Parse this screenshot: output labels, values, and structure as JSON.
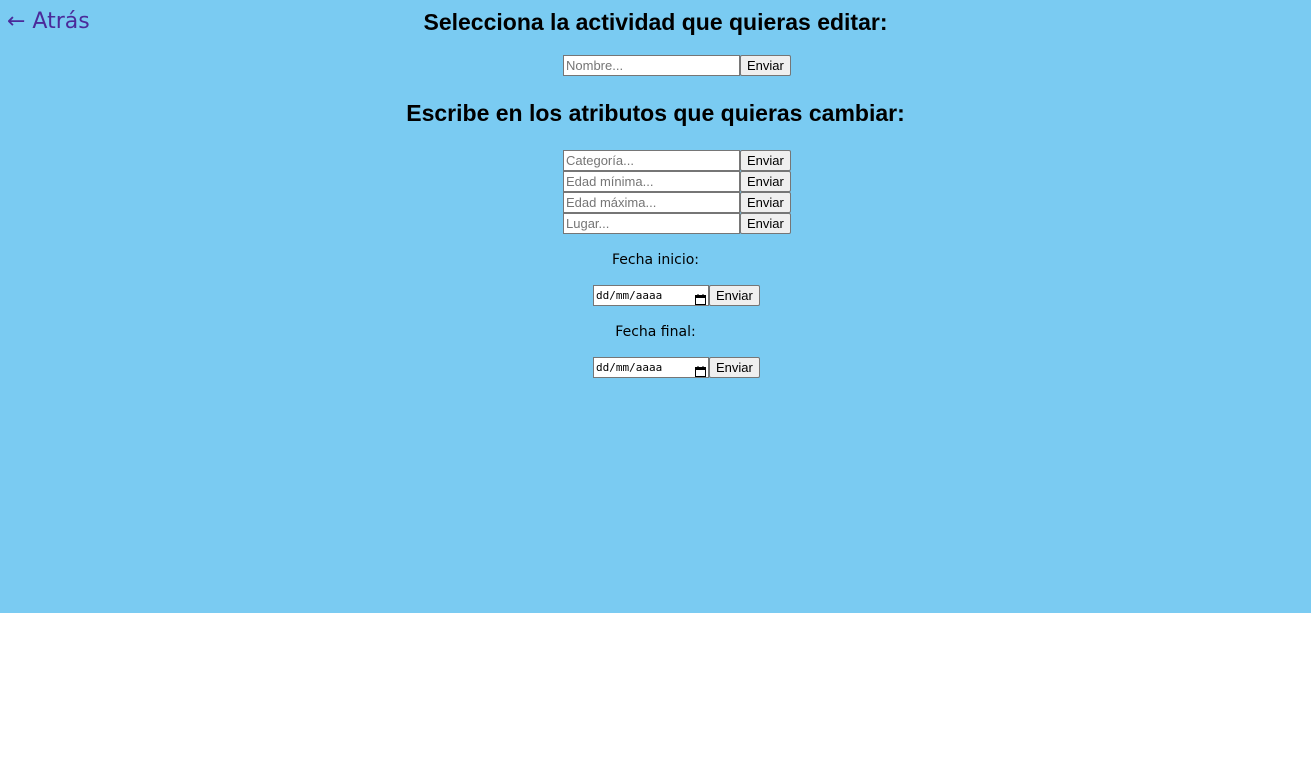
{
  "nav": {
    "back_label": "← Atrás"
  },
  "select_section": {
    "heading": "Selecciona la actividad que quieras editar:",
    "name_placeholder": "Nombre...",
    "send_label": "Enviar"
  },
  "edit_section": {
    "heading": "Escribe en los atributos que quieras cambiar:",
    "fields": [
      {
        "placeholder": "Categoría...",
        "send_label": "Enviar"
      },
      {
        "placeholder": "Edad mínima...",
        "send_label": "Enviar"
      },
      {
        "placeholder": "Edad máxima...",
        "send_label": "Enviar"
      },
      {
        "placeholder": "Lugar...",
        "send_label": "Enviar"
      }
    ],
    "start_date": {
      "label": "Fecha inicio:",
      "value": "dd/mm/aaaa",
      "send_label": "Enviar"
    },
    "end_date": {
      "label": "Fecha final:",
      "value": "dd/mm/aaaa",
      "send_label": "Enviar"
    }
  },
  "colors": {
    "background": "#7acbf2",
    "link": "#4b2a9a"
  },
  "icons": {
    "back": "arrow-left-icon",
    "date_picker": "calendar-icon"
  }
}
